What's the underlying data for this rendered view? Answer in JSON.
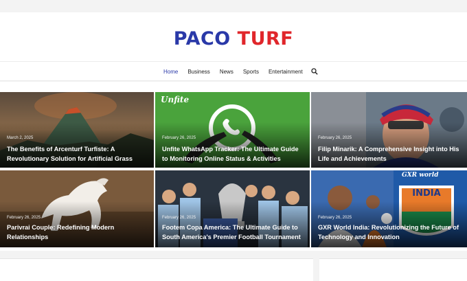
{
  "site": {
    "logo_part1": "PACO",
    "logo_part2": "TURF",
    "logo_colors": {
      "part1": "#2a39a8",
      "part2": "#e0262b"
    }
  },
  "nav": {
    "items": [
      {
        "label": "Home",
        "active": true
      },
      {
        "label": "Business",
        "active": false
      },
      {
        "label": "News",
        "active": false
      },
      {
        "label": "Sports",
        "active": false
      },
      {
        "label": "Entertainment",
        "active": false
      }
    ],
    "search_icon": "search-icon",
    "accent": "#2a39a8"
  },
  "cards": [
    {
      "date": "March 2, 2025",
      "title": "The Benefits of Arcenturf Turfiste: A Revolutionary Solution for Artificial Grass"
    },
    {
      "date": "February 26, 2025",
      "title": "Unfite WhatsApp Tracker: The Ultimate Guide to Monitoring Online Status & Activities",
      "overlay": "Unfite"
    },
    {
      "date": "February 26, 2025",
      "title": "Filip Minarik: A Comprehensive Insight into His Life and Achievements"
    },
    {
      "date": "February 26, 2025",
      "title": "Parivrai Couple: Redefining Modern Relationships"
    },
    {
      "date": "February 26, 2025",
      "title": "Footem Copa America: The Ultimate Guide to South America's Premier Football Tournament"
    },
    {
      "date": "February 26, 2025",
      "title": "GXR World India: Revolutionizing the Future of Technology and Innovation",
      "overlay": "GXR world",
      "badge": "INDIA"
    }
  ]
}
